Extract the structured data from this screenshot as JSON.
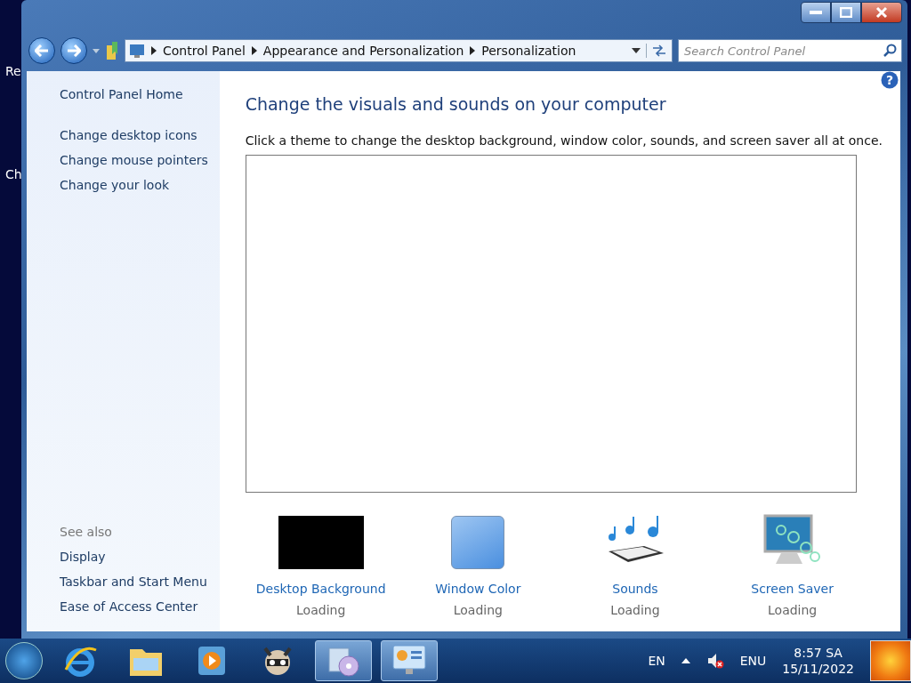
{
  "desktop_icons": [
    {
      "label": "Re"
    },
    {
      "label": "Ch"
    }
  ],
  "window": {
    "breadcrumb": [
      "Control Panel",
      "Appearance and Personalization",
      "Personalization"
    ],
    "search": {
      "placeholder": "Search Control Panel"
    }
  },
  "sidebar": {
    "home": "Control Panel Home",
    "links": [
      "Change desktop icons",
      "Change mouse pointers",
      "Change your look"
    ],
    "see_also_heading": "See also",
    "see_also": [
      "Display",
      "Taskbar and Start Menu",
      "Ease of Access Center"
    ]
  },
  "main": {
    "help": "?",
    "title": "Change the visuals and sounds on your computer",
    "description": "Click a theme to change the desktop background, window color, sounds, and screen saver all at once.",
    "settings": [
      {
        "kind": "background",
        "label": "Desktop Background",
        "status": "Loading"
      },
      {
        "kind": "color",
        "label": "Window Color",
        "status": "Loading"
      },
      {
        "kind": "sounds",
        "label": "Sounds",
        "status": "Loading"
      },
      {
        "kind": "saver",
        "label": "Screen Saver",
        "status": "Loading"
      }
    ]
  },
  "taskbar": {
    "apps": [
      {
        "kind": "ie",
        "selected": false
      },
      {
        "kind": "explorer",
        "selected": false
      },
      {
        "kind": "media",
        "selected": false
      },
      {
        "kind": "raccoon",
        "selected": false
      },
      {
        "kind": "installer",
        "selected": true
      },
      {
        "kind": "control",
        "selected": true
      }
    ],
    "language": "EN",
    "input": "ENU",
    "time": "8:57 SA",
    "date": "15/11/2022"
  }
}
